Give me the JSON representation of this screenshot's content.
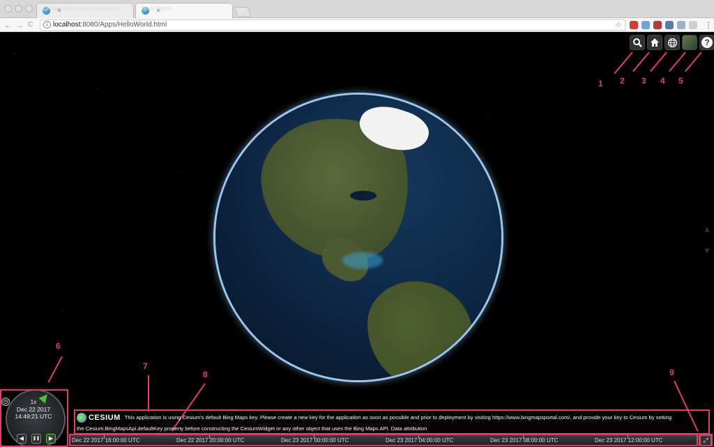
{
  "browser": {
    "tabs": [
      {
        "title": "Cesium Workshop | cesiumjs.o",
        "close": "×"
      },
      {
        "title": "Hello World!",
        "close": "×"
      }
    ],
    "nav": {
      "back": "←",
      "forward": "→",
      "reload": "C"
    },
    "url_host": "localhost",
    "url_path": ":8080/Apps/HelloWorld.html",
    "info_icon": "i",
    "bookmark_star": "☆",
    "menu": "⋮"
  },
  "toolbar": {
    "search": "search-icon",
    "home": "home-icon",
    "scene_mode": "globe-icon",
    "base_layer": "layer-picker",
    "help": "?"
  },
  "annotations": {
    "labels": [
      "1",
      "2",
      "3",
      "4",
      "5",
      "6",
      "7",
      "8",
      "9"
    ],
    "color": "#e63b6a"
  },
  "animation": {
    "speed": "1x",
    "date": "Dec 22 2017",
    "time": "14:49:21 UTC",
    "reverse": "◀",
    "pause": "❚❚",
    "play": "▶"
  },
  "credits": {
    "logo_text": "CESIUM",
    "line1": "This application is using Cesium's default Bing Maps key. Please create a new key for the application as soon as possible and prior to deployment by visiting https://www.bingmapsportal.com/, and provide your key to Cesium by setting",
    "line2": "the Cesium.BingMapsApi.defaultKey property before constructing the CesiumWidget or any other object that uses the Bing Maps API. Data attribution"
  },
  "timeline": {
    "labels": [
      "Dec 22 2017 16:00:00 UTC",
      "Dec 22 2017 20:00:00 UTC",
      "Dec 23 2017 00:00:00 UTC",
      "Dec 23 2017 04:00:00 UTC",
      "Dec 23 2017 08:00:00 UTC",
      "Dec 23 2017 12:00:00 UTC"
    ]
  },
  "fullscreen": "⤢"
}
